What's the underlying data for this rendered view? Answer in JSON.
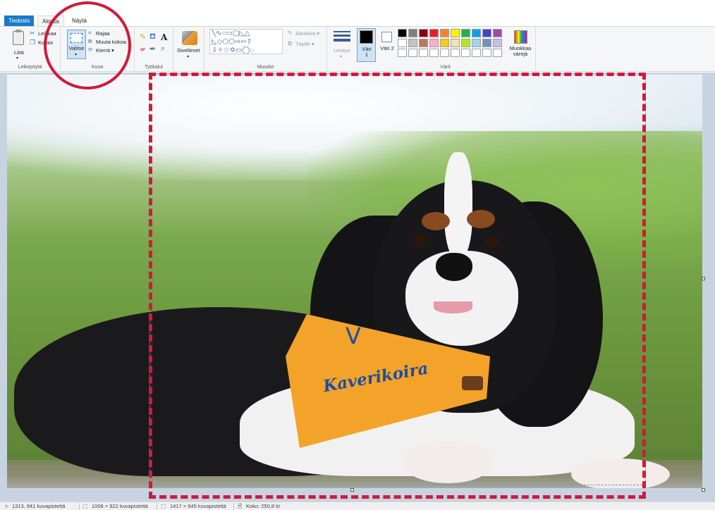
{
  "tabs": [
    {
      "label": "Tiedosto"
    },
    {
      "label": "Aloitus"
    },
    {
      "label": "Näytä"
    }
  ],
  "ribbon": {
    "clipboard": {
      "paste_label": "Liitä",
      "cut_label": "Leikkaa",
      "copy_label": "Kopioi",
      "group_label": "Leikepöytä"
    },
    "image": {
      "select_label": "Valitse",
      "crop_label": "Rajaa",
      "resize_label": "Muuta kokoa",
      "rotate_label": "Kierrä ▾",
      "group_label": "Kuva"
    },
    "tools": {
      "group_label": "Työkalut",
      "items": [
        "pencil-icon",
        "fill-icon",
        "text-icon",
        "eraser-icon",
        "color-picker-icon",
        "magnifier-icon"
      ],
      "text_glyph": "A"
    },
    "brushes": {
      "label": "Siveltimet"
    },
    "shapes": {
      "group_label": "Muodot",
      "glyph_row1": "╲∿○▭▢◺△",
      "glyph_row2": "◺◇⬠⬡⇨⇦⇧",
      "glyph_row3": "⇩✧☆✡▭◯◌",
      "outline_label": "Ääriviiva ▾",
      "fill_label": "Täyttö ▾"
    },
    "size": {
      "label": "Leveys"
    },
    "colors": {
      "color1_label": "Väri 1",
      "color2_label": "Väri 2",
      "color1": "#000000",
      "color2": "#ffffff",
      "edit_label": "Muokkaa värejä",
      "group_label": "Värit",
      "palette_row1": [
        "#000000",
        "#7f7f7f",
        "#880015",
        "#ed1c24",
        "#ff7f27",
        "#fff200",
        "#22b14c",
        "#00a2e8",
        "#3f48cc",
        "#a349a4"
      ],
      "palette_row2": [
        "#ffffff",
        "#c3c3c3",
        "#b97a57",
        "#ffaec9",
        "#ffc90e",
        "#efe4b0",
        "#b5e61d",
        "#99d9ea",
        "#7092be",
        "#c8bfe7"
      ],
      "palette_row3": [
        "#ffffff",
        "#ffffff",
        "#ffffff",
        "#ffffff",
        "#ffffff",
        "#ffffff",
        "#ffffff",
        "#ffffff",
        "#ffffff",
        "#ffffff"
      ]
    }
  },
  "canvas": {
    "bandana_text": "Kaverikoira",
    "bandana_mark": "V"
  },
  "status": {
    "cursor": "1313, 841 kuvapistettä",
    "selection": "1008 × 922 kuvapistettä",
    "image_size": "1417 × 945 kuvapistettä",
    "file_size": "Koko: 250,8 kt"
  }
}
